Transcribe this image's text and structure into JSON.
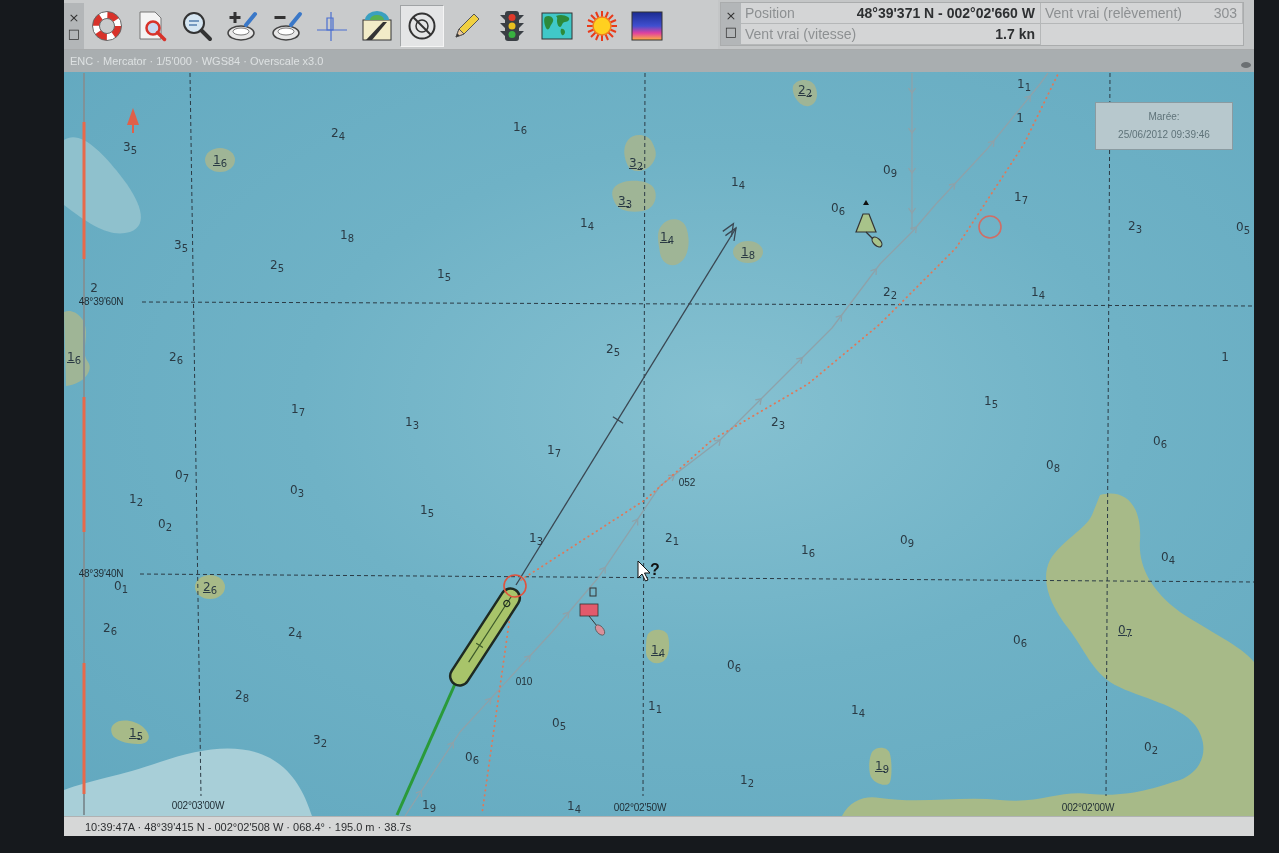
{
  "toolbar": {
    "window_controls": [
      "×",
      "□"
    ],
    "tools": [
      {
        "selected": false
      },
      {
        "selected": false
      },
      {
        "selected": false
      },
      {
        "selected": false
      },
      {
        "selected": false
      },
      {
        "selected": false
      },
      {
        "selected": false
      },
      {
        "selected": true
      },
      {
        "selected": false
      },
      {
        "selected": false
      },
      {
        "selected": false
      },
      {
        "selected": false
      },
      {
        "selected": false
      }
    ]
  },
  "readout_panel": {
    "window_controls": [
      "×",
      "□"
    ],
    "fields": [
      {
        "label": "Position",
        "value": "48°39'371 N - 002°02'660 W",
        "disabled": false
      },
      {
        "label": "Vent vrai (relèvement)",
        "value": "303",
        "disabled": true
      },
      {
        "label": "Vent vrai (vitesse)",
        "value": "1.7 kn",
        "disabled": false
      }
    ]
  },
  "chart_info": "ENC · Mercator · 1/5'000 · WGS84 · Overscale x3.0",
  "chart": {
    "grid_labels": [
      "48°39'60N",
      "48°39'40N",
      "002°03'00W",
      "002°02'50W",
      "002°02'00W"
    ],
    "tide_box": {
      "title": "Marée:",
      "timestamp": "25/06/2012 09:39:46"
    },
    "soundings": [
      {
        "text": "1$_{1}$",
        "drying": false
      },
      {
        "text": "2$_{2}$",
        "drying": true
      },
      {
        "text": "1",
        "drying": false
      },
      {
        "text": "1$_{6}$",
        "drying": false
      },
      {
        "text": "2$_{4}$",
        "drying": false
      },
      {
        "text": "3$_{5}$",
        "drying": false
      },
      {
        "text": "1$_{6}$",
        "drying": true
      },
      {
        "text": "3$_{2}$",
        "drying": true
      },
      {
        "text": "0$_{9}$",
        "drying": false
      },
      {
        "text": "1$_{4}$",
        "drying": false
      },
      {
        "text": "1$_{7}$",
        "drying": false
      },
      {
        "text": "3$_{3}$",
        "drying": true
      },
      {
        "text": "0$_{6}$",
        "drying": false
      },
      {
        "text": "1$_{4}$",
        "drying": false
      },
      {
        "text": "2$_{3}$",
        "drying": false
      },
      {
        "text": "0$_{5}$",
        "drying": false
      },
      {
        "text": "1$_{8}$",
        "drying": false
      },
      {
        "text": "1$_{4}$",
        "drying": true
      },
      {
        "text": "3$_{5}$",
        "drying": false
      },
      {
        "text": "1$_{8}$",
        "drying": true
      },
      {
        "text": "2$_{5}$",
        "drying": false
      },
      {
        "text": "1$_{5}$",
        "drying": false
      },
      {
        "text": "2",
        "drying": false
      },
      {
        "text": "2$_{2}$",
        "drying": false
      },
      {
        "text": "1$_{4}$",
        "drying": false
      },
      {
        "text": "2$_{5}$",
        "drying": false
      },
      {
        "text": "1$_{6}$",
        "drying": true
      },
      {
        "text": "2$_{6}$",
        "drying": false
      },
      {
        "text": "1",
        "drying": false
      },
      {
        "text": "1$_{5}$",
        "drying": false
      },
      {
        "text": "1$_{7}$",
        "drying": false
      },
      {
        "text": "1$_{3}$",
        "drying": false
      },
      {
        "text": "2$_{3}$",
        "drying": false
      },
      {
        "text": "0$_{6}$",
        "drying": false
      },
      {
        "text": "1$_{7}$",
        "drying": false
      },
      {
        "text": "0$_{8}$",
        "drying": false
      },
      {
        "text": "0$_{7}$",
        "drying": false
      },
      {
        "text": "0$_{3}$",
        "drying": false
      },
      {
        "text": "1$_{2}$",
        "drying": false
      },
      {
        "text": "1$_{5}$",
        "drying": false
      },
      {
        "text": "0$_{2}$",
        "drying": false
      },
      {
        "text": "1$_{3}$",
        "drying": false
      },
      {
        "text": "2$_{1}$",
        "drying": false
      },
      {
        "text": "0$_{9}$",
        "drying": false
      },
      {
        "text": "1$_{6}$",
        "drying": false
      },
      {
        "text": "0$_{4}$",
        "drying": false
      },
      {
        "text": "0$_{1}$",
        "drying": false
      },
      {
        "text": "2$_{6}$",
        "drying": true
      },
      {
        "text": "2$_{6}$",
        "drying": false
      },
      {
        "text": "2$_{4}$",
        "drying": false
      },
      {
        "text": "0$_{7}$",
        "drying": true
      },
      {
        "text": "0$_{6}$",
        "drying": false
      },
      {
        "text": "1$_{4}$",
        "drying": true
      },
      {
        "text": "0$_{6}$",
        "drying": false
      },
      {
        "text": "2$_{8}$",
        "drying": false
      },
      {
        "text": "1$_{1}$",
        "drying": false
      },
      {
        "text": "1$_{4}$",
        "drying": false
      },
      {
        "text": "0$_{5}$",
        "drying": false
      },
      {
        "text": "1$_{5}$",
        "drying": true
      },
      {
        "text": "3$_{2}$",
        "drying": false
      },
      {
        "text": "0$_{2}$",
        "drying": false
      },
      {
        "text": "0$_{6}$",
        "drying": false
      },
      {
        "text": "1$_{9}$",
        "drying": true
      },
      {
        "text": "1$_{2}$",
        "drying": false
      },
      {
        "text": "1$_{9}$",
        "drying": false
      },
      {
        "text": "1$_{4}$",
        "drying": false
      }
    ],
    "route_labels": [
      "052",
      "010"
    ],
    "cursor_label": "?"
  },
  "status_bar": "10:39:47A · 48°39'415 N - 002°02'508 W · 068.4° · 195.0 m · 38.7s"
}
